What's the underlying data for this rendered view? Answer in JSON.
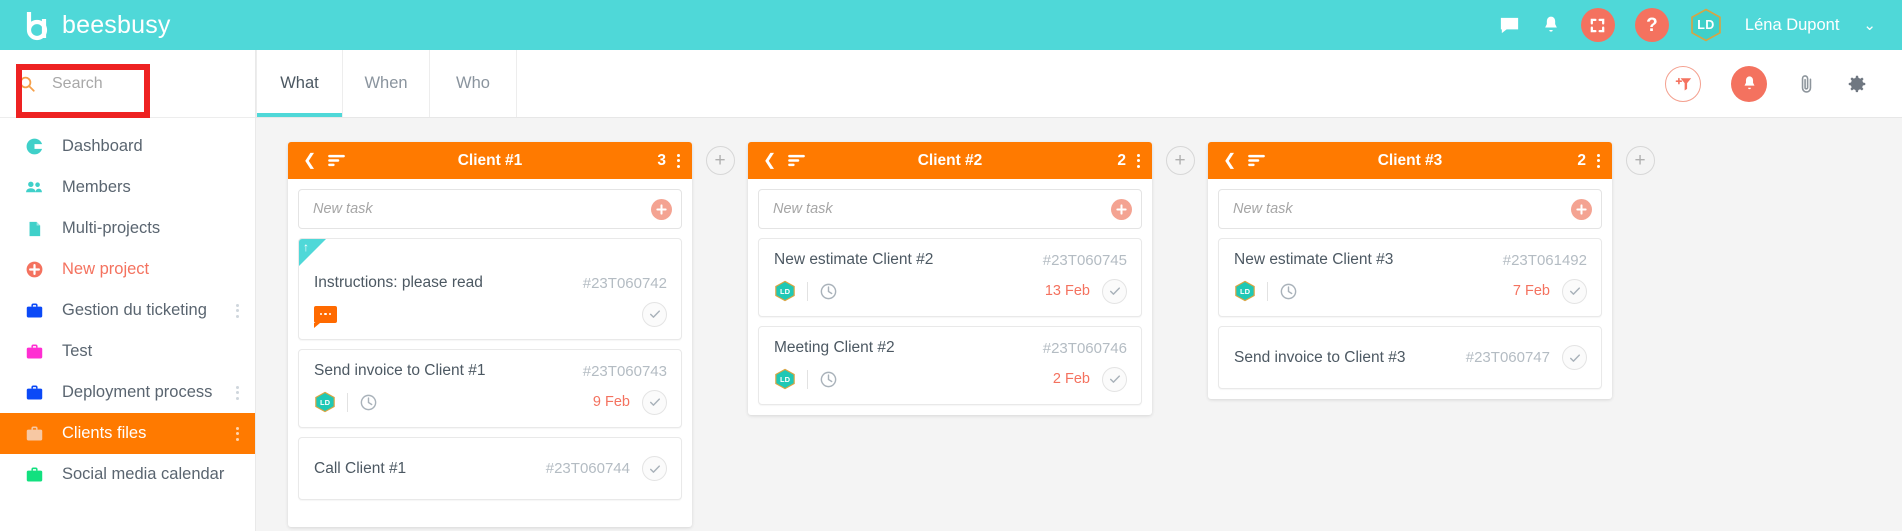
{
  "app": {
    "logo_text": "beesbusy",
    "brand_teal": "#4fd8d8",
    "brand_orange": "#ff7a00",
    "accent_salmon": "#f4725f"
  },
  "header": {
    "icons": [
      "chat-icon",
      "bell-icon",
      "fullscreen-icon",
      "help-icon"
    ],
    "help_label": "?",
    "avatar_initials": "LD",
    "user_name": "Léna Dupont",
    "chevron": "⌄"
  },
  "sidebar": {
    "search": {
      "placeholder": "Search",
      "value": ""
    },
    "items": [
      {
        "label": "Dashboard",
        "icon": "dashboard-icon",
        "color": "#3fd0c9",
        "active": false,
        "kebab": false
      },
      {
        "label": "Members",
        "icon": "members-icon",
        "color": "#3fd0c9",
        "active": false,
        "kebab": false
      },
      {
        "label": "Multi-projects",
        "icon": "document-icon",
        "color": "#3fd0c9",
        "active": false,
        "kebab": false
      },
      {
        "label": "New project",
        "icon": "plus-circle-icon",
        "color": "#f4725f",
        "active": false,
        "kebab": false
      },
      {
        "label": "Gestion du ticketing",
        "icon": "briefcase-icon",
        "color": "#0b49f7",
        "active": false,
        "kebab": true
      },
      {
        "label": "Test",
        "icon": "briefcase-icon",
        "color": "#ff2ed2",
        "active": false,
        "kebab": false
      },
      {
        "label": "Deployment process",
        "icon": "briefcase-icon",
        "color": "#0b49f7",
        "active": false,
        "kebab": true
      },
      {
        "label": "Clients files",
        "icon": "briefcase-icon",
        "color": "#f7c8a3",
        "active": true,
        "kebab": true
      },
      {
        "label": "Social media calendar",
        "icon": "briefcase-icon",
        "color": "#12e07f",
        "active": false,
        "kebab": false
      }
    ]
  },
  "toolbar": {
    "tabs": [
      {
        "label": "What",
        "active": true
      },
      {
        "label": "When",
        "active": false
      },
      {
        "label": "Who",
        "active": false
      }
    ],
    "actions": [
      "add-filter-icon",
      "notification-bell-icon",
      "attachment-icon",
      "settings-gear-icon"
    ]
  },
  "board": {
    "new_task_placeholder": "New task",
    "add_column_label": "+",
    "columns": [
      {
        "title": "Client #1",
        "count": "3",
        "cards": [
          {
            "title": "Instructions: please read",
            "id": "#23T060742",
            "ribbon": true,
            "assignee": "",
            "due": "",
            "comment": true
          },
          {
            "title": "Send invoice to Client #1",
            "id": "#23T060743",
            "ribbon": false,
            "assignee": "LD",
            "due": "9 Feb",
            "comment": false
          },
          {
            "title": "Call Client #1",
            "id": "#23T060744",
            "ribbon": false,
            "assignee": "",
            "due": "",
            "comment": false
          }
        ]
      },
      {
        "title": "Client #2",
        "count": "2",
        "cards": [
          {
            "title": "New estimate Client #2",
            "id": "#23T060745",
            "ribbon": false,
            "assignee": "LD",
            "due": "13 Feb",
            "comment": false
          },
          {
            "title": "Meeting Client #2",
            "id": "#23T060746",
            "ribbon": false,
            "assignee": "LD",
            "due": "2 Feb",
            "comment": false
          }
        ]
      },
      {
        "title": "Client #3",
        "count": "2",
        "cards": [
          {
            "title": "New estimate Client #3",
            "id": "#23T061492",
            "ribbon": false,
            "assignee": "LD",
            "due": "7 Feb",
            "comment": false
          },
          {
            "title": "Send invoice to Client #3",
            "id": "#23T060747",
            "ribbon": false,
            "assignee": "",
            "due": "",
            "comment": false
          }
        ]
      }
    ]
  },
  "annotation": {
    "highlight_color": "#ee2222",
    "target": "search-input"
  }
}
